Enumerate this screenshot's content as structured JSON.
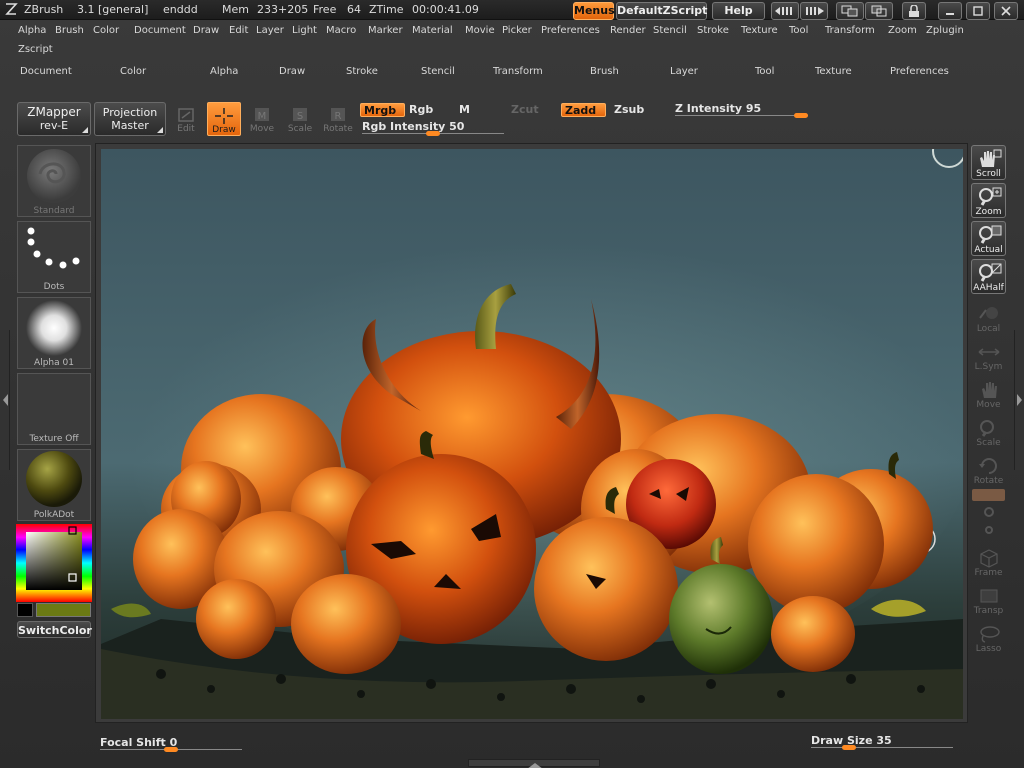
{
  "titlebar": {
    "app_name": "ZBrush",
    "version": "3.1 [general]",
    "document": "enddd",
    "mem_label": "Mem",
    "mem_value": "233+205",
    "free_label": "Free",
    "free_value": "64",
    "ztime_label": "ZTime",
    "ztime_value": "00:00:41.09",
    "menus_button": "Menus",
    "script_button": "DefaultZScript",
    "help_button": "Help"
  },
  "menubar": {
    "items": [
      "Alpha",
      "Brush",
      "Color",
      "Document",
      "Draw",
      "Edit",
      "Layer",
      "Light",
      "Macro",
      "Marker",
      "Material",
      "Movie",
      "Picker",
      "Preferences",
      "Render",
      "Stencil",
      "Stroke",
      "Texture",
      "Tool",
      "Transform",
      "Zoom",
      "Zplugin"
    ],
    "second_row": [
      "Zscript"
    ]
  },
  "palettebar": {
    "items": [
      "Document",
      "Color",
      "Alpha",
      "Draw",
      "Stroke",
      "Stencil",
      "Transform",
      "Brush",
      "Layer",
      "Tool",
      "Texture",
      "Preferences"
    ]
  },
  "toolbar": {
    "zmapper_line1": "ZMapper",
    "zmapper_line2": "rev-E",
    "projection_line1": "Projection",
    "projection_line2": "Master",
    "tools": [
      {
        "label": "Edit",
        "state": "dim"
      },
      {
        "label": "Draw",
        "state": "active"
      },
      {
        "label": "Move",
        "state": "dim"
      },
      {
        "label": "Scale",
        "state": "dim"
      },
      {
        "label": "Rotate",
        "state": "dim"
      }
    ],
    "mrgb": "Mrgb",
    "rgb": "Rgb",
    "m": "M",
    "zcut": "Zcut",
    "zadd": "Zadd",
    "zsub": "Zsub",
    "rgb_intensity_label": "Rgb Intensity",
    "rgb_intensity_value": "50",
    "rgb_intensity_fraction": 0.5,
    "z_intensity_label": "Z Intensity",
    "z_intensity_value": "95",
    "z_intensity_fraction": 0.95
  },
  "left_shelf": {
    "brush": "Standard",
    "stroke": "Dots",
    "alpha": "Alpha 01",
    "texture": "Texture Off",
    "material": "PolkADot",
    "switch_color": "SwitchColor"
  },
  "right_shelf": [
    {
      "label": "Scroll",
      "state": "active"
    },
    {
      "label": "Zoom",
      "state": "active"
    },
    {
      "label": "Actual",
      "state": "active"
    },
    {
      "label": "AAHalf",
      "state": "active"
    },
    {
      "label": "Local",
      "state": "dim"
    },
    {
      "label": "L.Sym",
      "state": "dim"
    },
    {
      "label": "Move",
      "state": "dim"
    },
    {
      "label": "Scale",
      "state": "dim"
    },
    {
      "label": "Rotate",
      "state": "dim"
    },
    {
      "label": "Frame",
      "state": "dim"
    },
    {
      "label": "Transp",
      "state": "dim"
    },
    {
      "label": "Lasso",
      "state": "dim"
    }
  ],
  "bottom": {
    "focal_shift_label": "Focal Shift",
    "focal_shift_value": "0",
    "focal_shift_fraction": 0.5,
    "draw_size_label": "Draw Size",
    "draw_size_value": "35",
    "draw_size_fraction": 0.27
  },
  "colors": {
    "accent": "#ff8a22",
    "main_color": "#ffffff",
    "secondary_color": "#6b7a14",
    "canvas_bg_top": "#3d5660",
    "canvas_bg_bottom": "#22332f"
  }
}
